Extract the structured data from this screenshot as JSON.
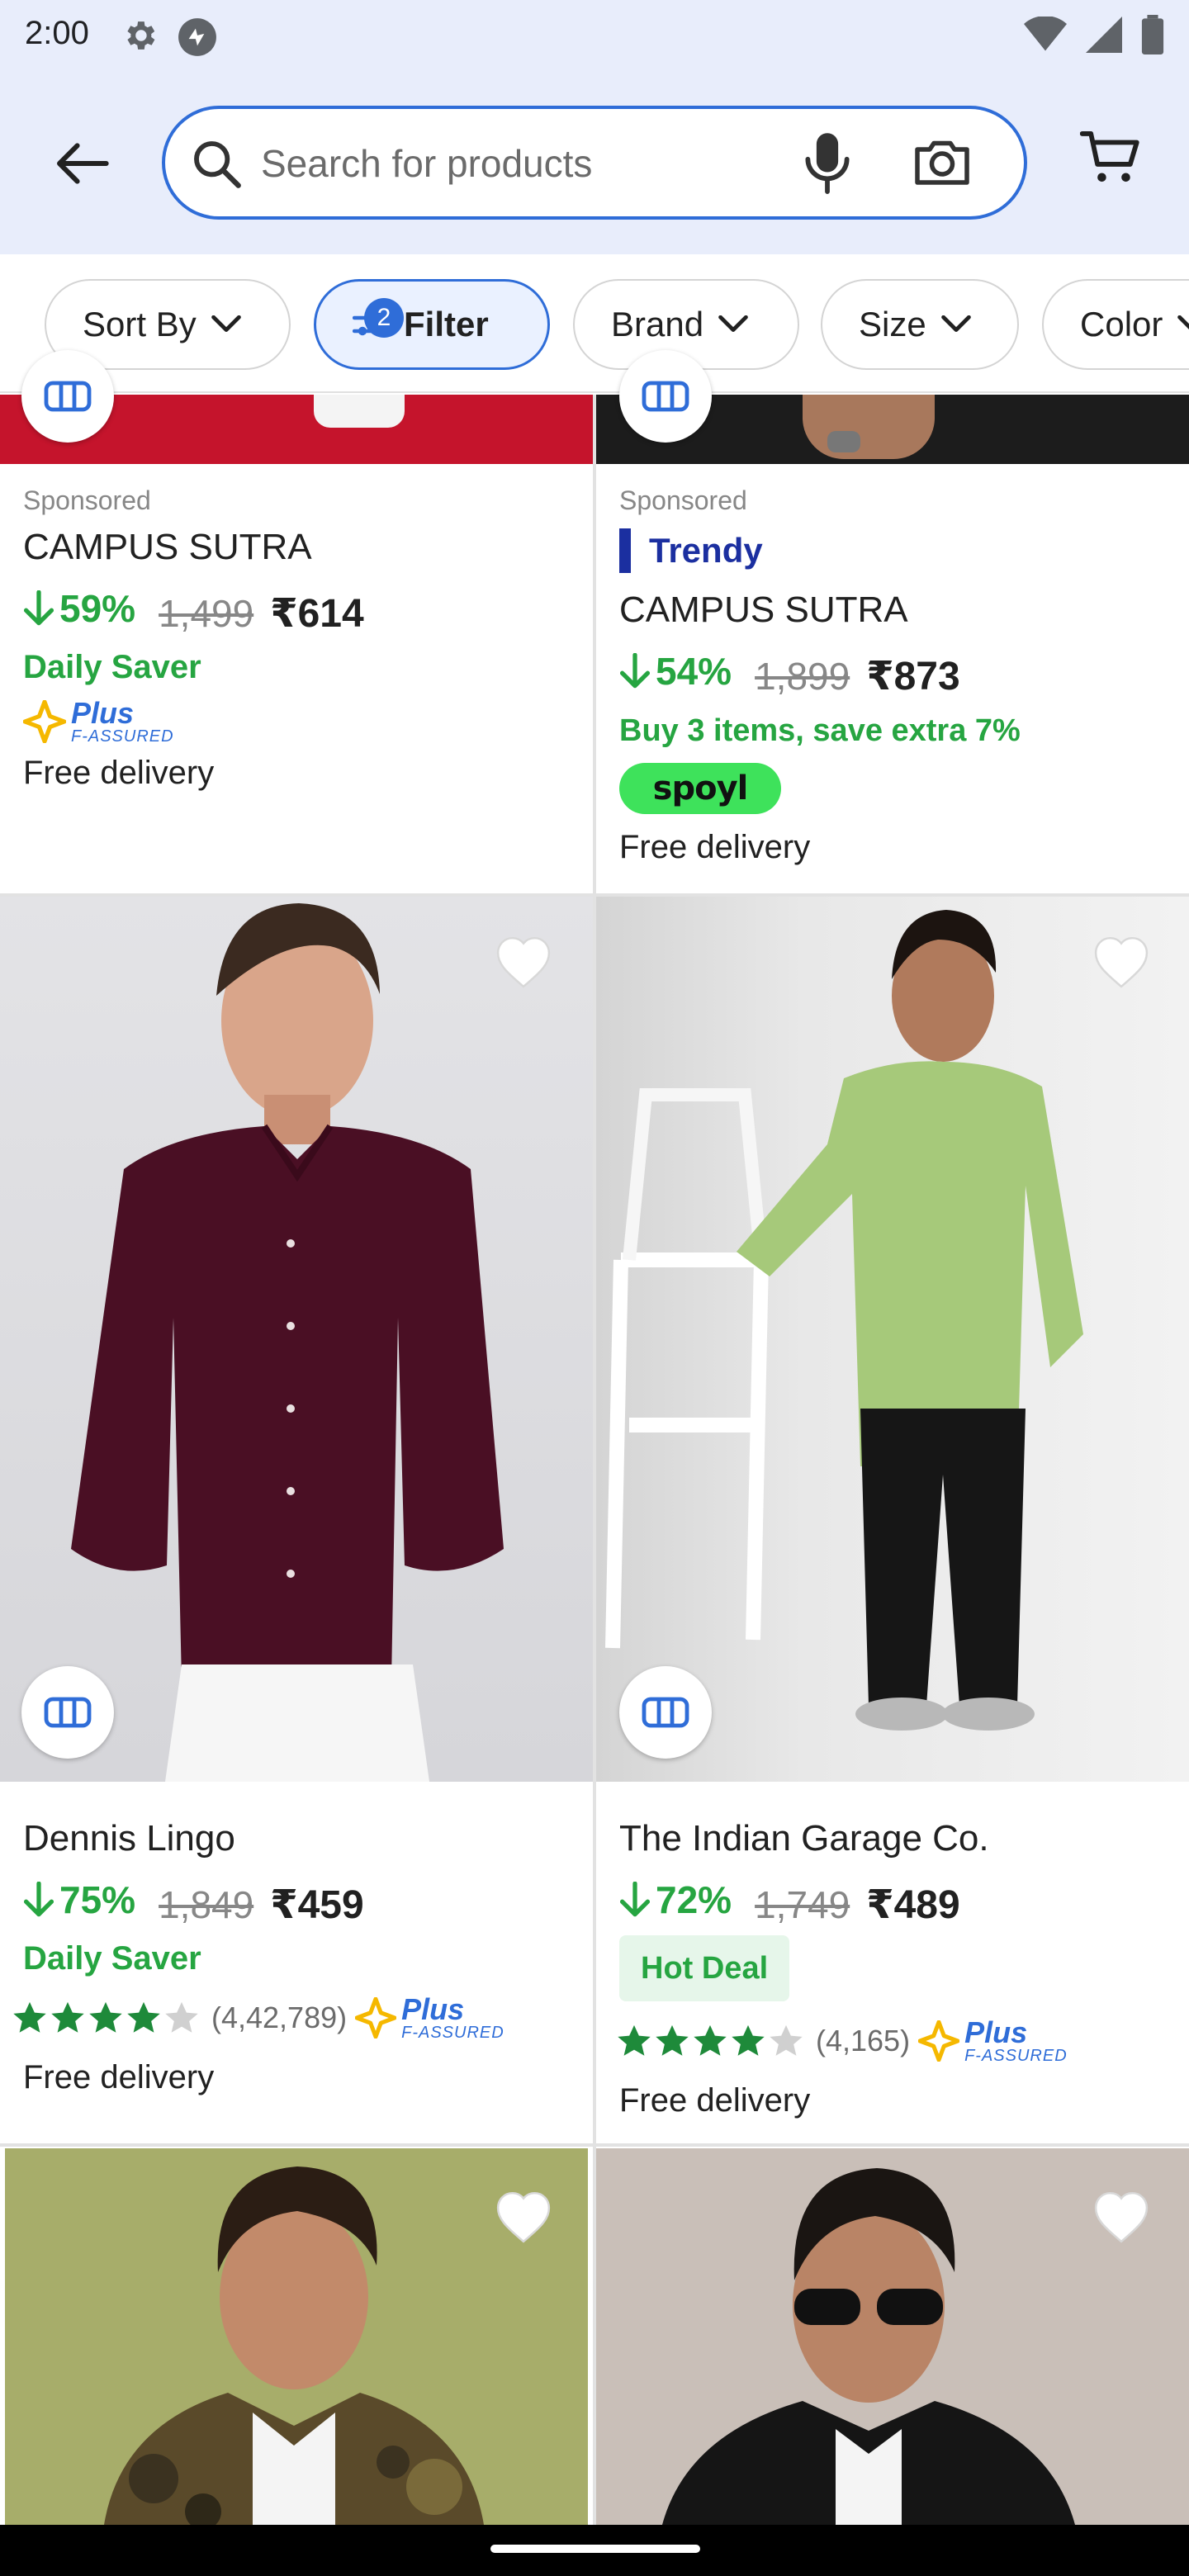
{
  "status_bar": {
    "time": "2:00"
  },
  "search": {
    "placeholder": "Search for products"
  },
  "chips": {
    "sort_by": "Sort By",
    "filter": "Filter",
    "filter_count": "2",
    "brand": "Brand",
    "size": "Size",
    "color": "Color"
  },
  "products": [
    {
      "sponsored": "Sponsored",
      "brand": "CAMPUS SUTRA",
      "discount": "59%",
      "mrp": "1,499",
      "price": "₹614",
      "tag": "Daily Saver",
      "plus_label": "Plus",
      "plus_sub": "F-ASSURED",
      "delivery": "Free delivery"
    },
    {
      "sponsored": "Sponsored",
      "trendy": "Trendy",
      "brand": "CAMPUS SUTRA",
      "discount": "54%",
      "mrp": "1,899",
      "price": "₹873",
      "offer": "Buy 3 items, save extra 7%",
      "partner": "spoyl",
      "delivery": "Free delivery"
    },
    {
      "brand": "Dennis Lingo",
      "discount": "75%",
      "mrp": "1,849",
      "price": "₹459",
      "tag": "Daily Saver",
      "rating_stars": 4,
      "rating_count": "(4,42,789)",
      "plus_label": "Plus",
      "plus_sub": "F-ASSURED",
      "delivery": "Free delivery"
    },
    {
      "brand": "The Indian Garage Co.",
      "discount": "72%",
      "mrp": "1,749",
      "price": "₹489",
      "tag": "Hot Deal",
      "rating_stars": 4,
      "rating_count": "(4,165)",
      "plus_label": "Plus",
      "plus_sub": "F-ASSURED",
      "delivery": "Free delivery"
    }
  ],
  "colors": {
    "accent": "#2f6dd8",
    "discount_green": "#26a541",
    "header_bg": "#e8edfb",
    "plus_gold": "#f5b800"
  }
}
